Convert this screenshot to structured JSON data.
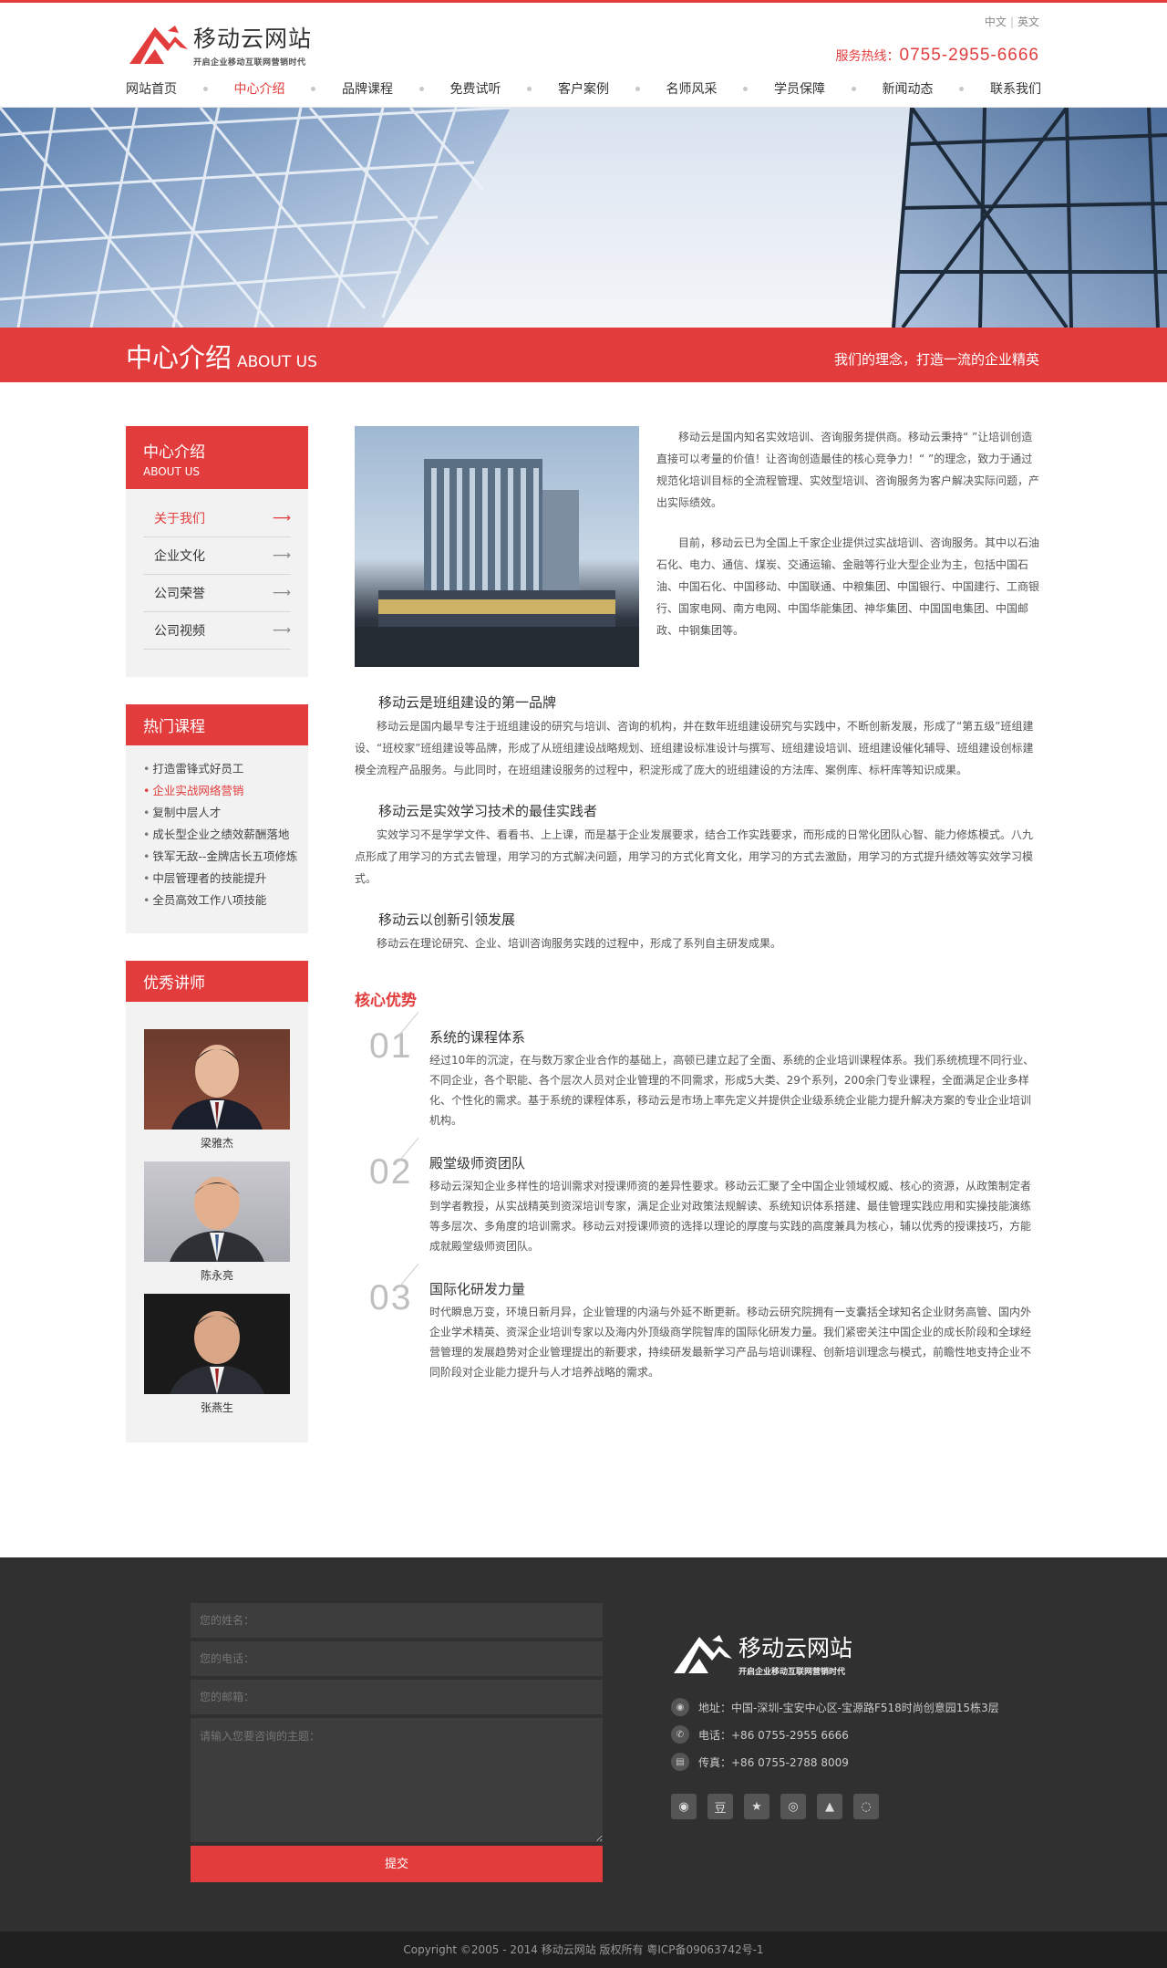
{
  "header": {
    "logo_title": "移动云网站",
    "logo_slogan": "开启企业移动互联网营销时代",
    "lang_cn": "中文",
    "lang_en": "英文",
    "hotline_label": "服务热线：",
    "hotline_number": "0755-2955-6666"
  },
  "nav": [
    {
      "label": "网站首页"
    },
    {
      "label": "中心介绍"
    },
    {
      "label": "品牌课程"
    },
    {
      "label": "免费试听"
    },
    {
      "label": "客户案例"
    },
    {
      "label": "名师风采"
    },
    {
      "label": "学员保障"
    },
    {
      "label": "新闻动态"
    },
    {
      "label": "联系我们"
    }
  ],
  "title_bar": {
    "cn": "中心介绍",
    "en": "ABOUT US",
    "slogan": "我们的理念，打造一流的企业精英"
  },
  "sidebar": {
    "about": {
      "title_cn": "中心介绍",
      "title_en": "ABOUT US",
      "items": [
        {
          "label": "关于我们"
        },
        {
          "label": "企业文化"
        },
        {
          "label": "公司荣誉"
        },
        {
          "label": "公司视频"
        }
      ]
    },
    "courses": {
      "title": "热门课程",
      "items": [
        {
          "label": "打造雷锋式好员工"
        },
        {
          "label": "企业实战网络营销"
        },
        {
          "label": "复制中层人才"
        },
        {
          "label": "成长型企业之绩效薪酬落地"
        },
        {
          "label": "铁军无敌--金牌店长五项修炼"
        },
        {
          "label": "中层管理者的技能提升"
        },
        {
          "label": "全员高效工作八项技能"
        }
      ]
    },
    "teachers": {
      "title": "优秀讲师",
      "items": [
        {
          "name": "梁雅杰"
        },
        {
          "name": "陈永亮"
        },
        {
          "name": "张燕生"
        }
      ]
    }
  },
  "content": {
    "intro_p1": "移动云是国内知名实效培训、咨询服务提供商。移动云秉持“ ”让培训创造直接可以考量的价值！让咨询创造最佳的核心竞争力！“ ”的理念，致力于通过规范化培训目标的全流程管理、实效型培训、咨询服务为客户解决实际问题，产出实际绩效。",
    "intro_p2": "目前，移动云已为全国上千家企业提供过实战培训、咨询服务。其中以石油石化、电力、通信、煤炭、交通运输、金融等行业大型企业为主，包括中国石油、中国石化、中国移动、中国联通、中粮集团、中国银行、中国建行、工商银行、国家电网、南方电网、中国华能集团、神华集团、中国国电集团、中国邮政、中钢集团等。",
    "features": [
      {
        "title": "移动云是班组建设的第一品牌",
        "text": "移动云是国内最早专注于班组建设的研究与培训、咨询的机构，并在数年班组建设研究与实践中，不断创新发展，形成了“第五级”班组建设、“班校家”班组建设等品牌，形成了从班组建设战略规划、班组建设标准设计与撰写、班组建设培训、班组建设催化辅导、班组建设创标建模全流程产品服务。与此同时，在班组建设服务的过程中，积淀形成了庞大的班组建设的方法库、案例库、标杆库等知识成果。"
      },
      {
        "title": "移动云是实效学习技术的最佳实践者",
        "text": "实效学习不是学学文件、看看书、上上课，而是基于企业发展要求，结合工作实践要求，而形成的日常化团队心智、能力修炼模式。八九点形成了用学习的方式去管理，用学习的方式解决问题，用学习的方式化育文化，用学习的方式去激励，用学习的方式提升绩效等实效学习模式。"
      },
      {
        "title": "移动云以创新引领发展",
        "text": "移动云在理论研究、企业、培训咨询服务实践的过程中，形成了系列自主研发成果。"
      }
    ],
    "core_title": "核心优势",
    "core": [
      {
        "num": "01",
        "title": "系统的课程体系",
        "text": "经过10年的沉淀，在与数万家企业合作的基础上，高顿已建立起了全面、系统的企业培训课程体系。我们系统梳理不同行业、不同企业，各个职能、各个层次人员对企业管理的不同需求，形成5大类、29个系列，200余门专业课程，全面满足企业多样化、个性化的需求。基于系统的课程体系，移动云是市场上率先定义并提供企业级系统企业能力提升解决方案的专业企业培训机构。"
      },
      {
        "num": "02",
        "title": "殿堂级师资团队",
        "text": "移动云深知企业多样性的培训需求对授课师资的差异性要求。移动云汇聚了全中国企业领域权威、核心的资源，从政策制定者到学者教授，从实战精英到资深培训专家，满足企业对政策法规解读、系统知识体系搭建、最佳管理实践应用和实操技能演练等多层次、多角度的培训需求。移动云对授课师资的选择以理论的厚度与实践的高度兼具为核心，辅以优秀的授课技巧，方能成就殿堂级师资团队。"
      },
      {
        "num": "03",
        "title": "国际化研发力量",
        "text": "时代瞬息万变，环境日新月异，企业管理的内涵与外延不断更新。移动云研究院拥有一支囊括全球知名企业财务高管、国内外企业学术精英、资深企业培训专家以及海内外顶级商学院智库的国际化研发力量。我们紧密关注中国企业的成长阶段和全球经营管理的发展趋势对企业管理提出的新要求，持续研发最新学习产品与培训课程、创新培训理念与模式，前瞻性地支持企业不同阶段对企业能力提升与人才培养战略的需求。"
      }
    ]
  },
  "footer": {
    "name_placeholder": "您的姓名：",
    "phone_placeholder": "您的电话：",
    "email_placeholder": "您的邮箱：",
    "message_placeholder": "请输入您要咨询的主题：",
    "submit_label": "提交",
    "logo_title": "移动云网站",
    "logo_slogan": "开启企业移动互联网营销时代",
    "address": "地址：中国-深圳-宝安中心区-宝源路F518时尚创意园15栋3层",
    "phone": "电话：+86 0755-2955 6666",
    "fax": "传真：+86 0755-2788 8009",
    "socials": [
      {
        "icon": "wechat-icon",
        "glyph": "◉"
      },
      {
        "icon": "douban-icon",
        "glyph": "豆"
      },
      {
        "icon": "star-icon",
        "glyph": "★"
      },
      {
        "icon": "weibo-icon",
        "glyph": "◎"
      },
      {
        "icon": "renren-icon",
        "glyph": "▲"
      },
      {
        "icon": "qq-icon",
        "glyph": "◌"
      }
    ],
    "copyright": "Copyright ©2005 - 2014  移动云网站 版权所有     粤ICP备09063742号-1"
  },
  "colors": {
    "accent": "#e23c3c",
    "footer_bg": "#303030",
    "copyright_bg": "#202020"
  }
}
